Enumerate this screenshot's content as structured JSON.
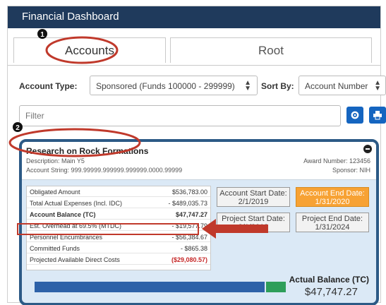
{
  "window": {
    "title": "Financial Dashboard"
  },
  "tabs": [
    {
      "label": "Accounts",
      "active": true
    },
    {
      "label": "Root",
      "active": false
    }
  ],
  "filters": {
    "account_type_label": "Account Type:",
    "account_type_value": "Sponsored (Funds 100000 - 299999)",
    "sort_by_label": "Sort By:",
    "sort_by_value": "Account Number",
    "filter_placeholder": "Filter"
  },
  "card": {
    "title": "Research on Rock Formations",
    "description": "Description: Main Y5",
    "account_string": "Account String: 999.99999.999999.999999.0000.99999",
    "award_number": "Award Number: 123456",
    "sponsor": "Sponsor: NIH",
    "rows": [
      {
        "label": "Obligated Amount",
        "value": "$536,783.00",
        "style": "normal"
      },
      {
        "label": "Total Actual Expenses (Incl. IDC)",
        "value": "- $489,035.73",
        "style": "normal"
      },
      {
        "label": "Account Balance (TC)",
        "value": "$47,747.27",
        "style": "bold"
      },
      {
        "label": "Est. Overhead at 69.5% (MTDC)",
        "value": "- $19,577.79",
        "style": "normal"
      },
      {
        "label": "Personnel Encumbrances",
        "value": "- $56,384.67",
        "style": "normal"
      },
      {
        "label": "Committed Funds",
        "value": "- $865.38",
        "style": "normal"
      },
      {
        "label": "Projected Available Direct Costs",
        "value": "($29,080.57)",
        "style": "red"
      }
    ],
    "dates": [
      {
        "label": "Account Start Date:",
        "value": "2/1/2019",
        "alert": false
      },
      {
        "label": "Account End Date:",
        "value": "1/31/2020",
        "alert": true
      },
      {
        "label": "Project Start Date:",
        "value": "2/1/2019",
        "alert": false
      },
      {
        "label": "Project End Date:",
        "value": "1/31/2024",
        "alert": false
      }
    ],
    "actual_balance_label": "Actual Balance (TC)",
    "actual_balance_value": "$47,747.27",
    "spent_fraction": 0.917
  },
  "annotations": {
    "marker_1": "1",
    "marker_2": "2"
  },
  "colors": {
    "header_bg": "#1f3a5c",
    "card_border": "#2c5a86",
    "action_blue": "#1565c0",
    "alert_orange": "#f7a234",
    "annotation_red": "#c0392b",
    "bar_blue": "#2e62a8",
    "bar_green": "#2e9e5a"
  }
}
